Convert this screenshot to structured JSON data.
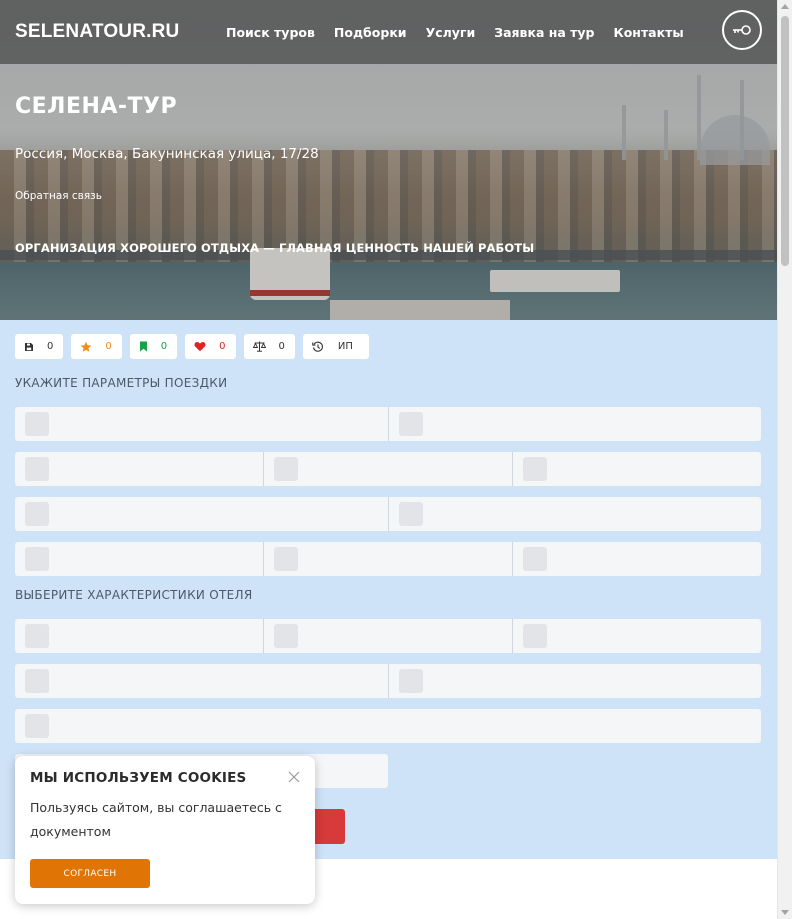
{
  "header": {
    "logo": "SELENATOUR.RU",
    "nav": [
      "Поиск туров",
      "Подборки",
      "Услуги",
      "Заявка на тур",
      "Контакты"
    ],
    "login_icon": "key-icon"
  },
  "hero": {
    "title": "СЕЛЕНА-ТУР",
    "address": "Россия, Москва, Бакунинская улица, 17/28",
    "feedback": "Обратная связь",
    "slogan": "ОРГАНИЗАЦИЯ ХОРОШЕГО ОТДЫХА — ГЛАВНАЯ ЦЕННОСТЬ НАШЕЙ РАБОТЫ"
  },
  "counters": [
    {
      "icon": "save-icon",
      "value": "0",
      "color": "#333333"
    },
    {
      "icon": "star-icon",
      "value": "0",
      "color": "#f08c1a"
    },
    {
      "icon": "bookmark-icon",
      "value": "0",
      "color": "#17a34a"
    },
    {
      "icon": "heart-icon",
      "value": "0",
      "color": "#e02424"
    },
    {
      "icon": "scales-icon",
      "value": "0",
      "color": "#333333"
    },
    {
      "icon": "history-icon",
      "value": "ИП",
      "color": "#333333"
    }
  ],
  "sections": {
    "trip_params": "УКАЖИТЕ ПАРАМЕТРЫ ПОЕЗДКИ",
    "hotel_features": "ВЫБЕРИТЕ ХАРАКТЕРИСТИКИ ОТЕЛЯ"
  },
  "cookie": {
    "title": "МЫ ИСПОЛЬЗУЕМ COOKIES",
    "text": "Пользуясь сайтом, вы соглашаетесь с документом",
    "button": "СОГЛАСЕН"
  },
  "colors": {
    "form_bg": "#cfe3f8",
    "submit": "#d63a3a",
    "cookie_button": "#e07405"
  }
}
